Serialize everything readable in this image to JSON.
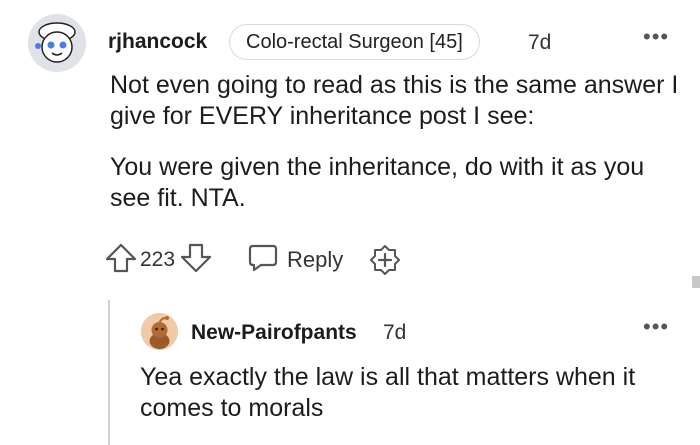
{
  "comment": {
    "username": "rjhancock",
    "flair": "Colo-rectal Surgeon [45]",
    "time": "7d",
    "more": "•••",
    "paragraphs": [
      "Not even going to read as this is the same answer I give for EVERY inheritance post I see:",
      "You were given the inheritance, do with it as you see fit. NTA."
    ],
    "upvotes": "223",
    "reply_label": "Reply"
  },
  "reply": {
    "username": "New-Pairofpants",
    "time": "7d",
    "more": "•••",
    "text": "Yea exactly the law is all that matters when it comes to morals"
  },
  "colors": {
    "avatar_main_bg": "#dfe3e8",
    "avatar_reply_bg": "#f0c9a6",
    "text": "#1c1c1c",
    "meta": "#333333"
  },
  "icons": [
    "avatar-icon",
    "upvote-icon",
    "downvote-icon",
    "reply-icon",
    "award-icon",
    "more-icon"
  ]
}
